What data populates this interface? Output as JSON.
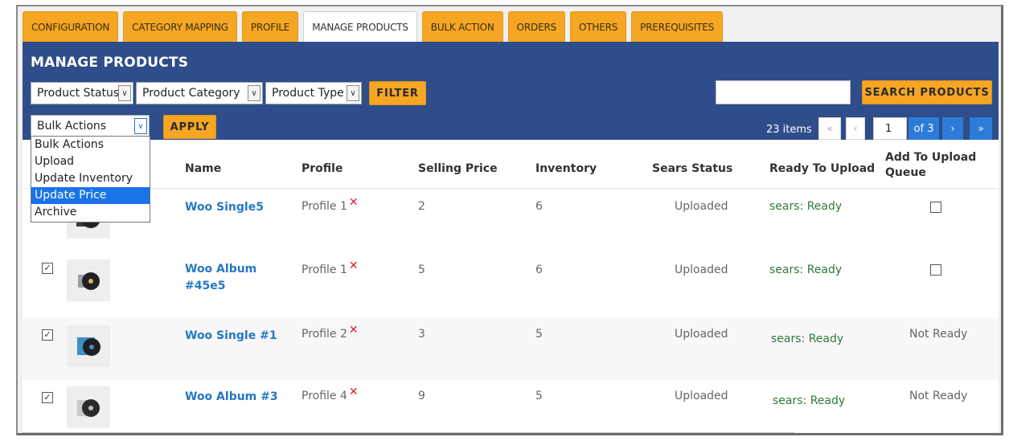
{
  "tabs": [
    "CONFIGURATION",
    "CATEGORY MAPPING",
    "PROFILE",
    "MANAGE PRODUCTS",
    "BULK ACTION",
    "ORDERS",
    "OTHERS",
    "PREREQUISITES"
  ],
  "active_tab": "MANAGE PRODUCTS",
  "panel": {
    "title": "MANAGE PRODUCTS",
    "filters": {
      "product_status": "Product Status",
      "product_category": "Product Category",
      "product_type": "Product Type",
      "filter_button": "FILTER"
    },
    "search": {
      "value": "",
      "button": "SEARCH PRODUCTS"
    },
    "bulk": {
      "selected": "Bulk Actions",
      "apply_button": "APPLY"
    },
    "pager": {
      "count": "23 items",
      "first": "«",
      "prev": "‹",
      "page": "1",
      "of": "of 3",
      "next": "›",
      "last": "»"
    }
  },
  "bulk_dropdown": {
    "options": [
      "Bulk Actions",
      "Upload",
      "Update Inventory",
      "Update Price",
      "Archive"
    ],
    "highlighted": "Update Price"
  },
  "table": {
    "headers": {
      "name": "Name",
      "profile": "Profile",
      "price": "Selling Price",
      "inventory": "Inventory",
      "status": "Sears Status",
      "ready": "Ready To Upload",
      "queue_line1": "Add To Upload",
      "queue_line2": "Queue"
    },
    "rows": [
      {
        "checked": false,
        "name": "Woo Single5",
        "name2": "",
        "profile": "Profile 1",
        "price": "2",
        "inventory": "6",
        "status": "Uploaded",
        "ready": "sears: Ready",
        "queue": "checkbox",
        "queue_text": ""
      },
      {
        "checked": true,
        "name": "Woo Album",
        "name2": "#45e5",
        "profile": "Profile 1",
        "price": "5",
        "inventory": "6",
        "status": "Uploaded",
        "ready": "sears: Ready",
        "queue": "checkbox",
        "queue_text": ""
      },
      {
        "checked": true,
        "name": "Woo Single #1",
        "name2": "",
        "profile": "Profile 2",
        "price": "3",
        "inventory": "5",
        "status": "Uploaded",
        "ready": "sears: Ready",
        "queue": "text",
        "queue_text": "Not Ready"
      },
      {
        "checked": true,
        "name": "Woo Album #3",
        "name2": "",
        "profile": "Profile 4",
        "price": "9",
        "inventory": "5",
        "status": "Uploaded",
        "ready": "sears: Ready",
        "queue": "text",
        "queue_text": "Not Ready"
      }
    ],
    "check_mark": "✓",
    "remove_mark": "✕"
  },
  "colors": {
    "accent": "#f5a623",
    "panel": "#2f4d8a",
    "link": "#2577c4",
    "ready": "#2f7a3c"
  }
}
